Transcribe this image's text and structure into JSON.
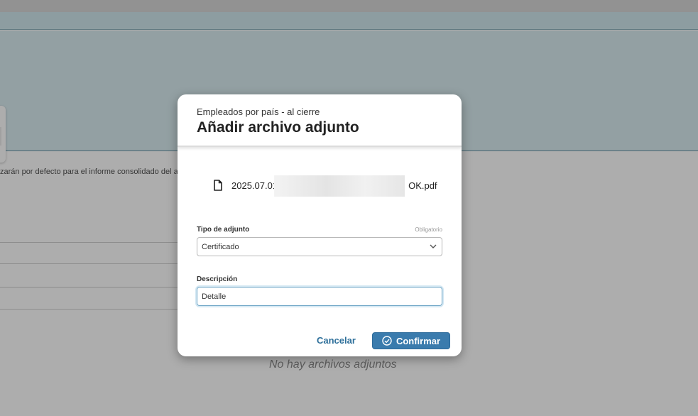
{
  "background": {
    "info_text": "zarán por defecto para el informe consolidado del a",
    "empty_text": "No hay archivos adjuntos"
  },
  "modal": {
    "subtitle": "Empleados por país - al cierre",
    "title": "Añadir archivo adjunto",
    "file": {
      "icon": "file-icon",
      "name_visible_prefix": "2025.07.01",
      "name_visible_suffix": "OK.pdf"
    },
    "attachment_type": {
      "label": "Tipo de adjunto",
      "required_note": "Obligatorio",
      "selected_value": "Certificado",
      "icon": "chevron-down-icon"
    },
    "description": {
      "label": "Descripción",
      "value": "Detalle"
    },
    "actions": {
      "cancel_label": "Cancelar",
      "confirm_label": "Confirmar",
      "confirm_icon": "check-circle-icon"
    }
  },
  "colors": {
    "primary": "#3a7bad",
    "link": "#2d6f9a",
    "banner": "#d3e8ee"
  }
}
